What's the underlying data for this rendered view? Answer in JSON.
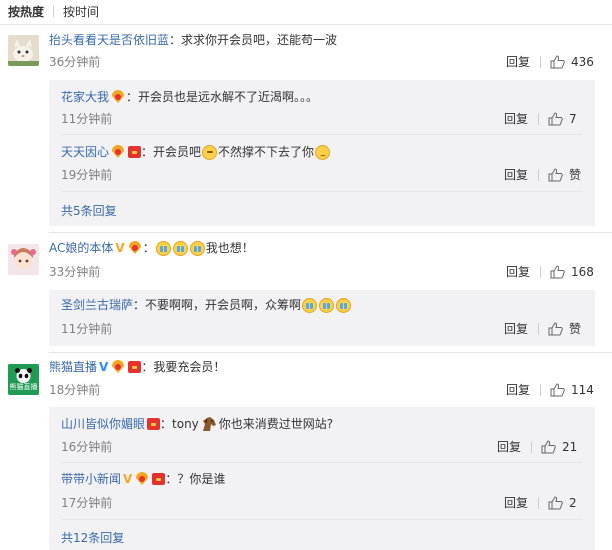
{
  "sort": {
    "hot": "按热度",
    "time": "按时间"
  },
  "comments": [
    {
      "user": "抬头看看天是否依旧蓝",
      "text": "求求你开会员吧，还能苟一波",
      "time": "36分钟前",
      "reply_label": "回复",
      "likes": "436",
      "replies": [
        {
          "user": "花家大我",
          "text": "开会员也是远水解不了近渴啊。。。",
          "time": "11分钟前",
          "reply_label": "回复",
          "likes": "7"
        },
        {
          "user": "天天因心",
          "text_a": "开会员吧",
          "text_b": "不然撑不下去了你",
          "time": "19分钟前",
          "reply_label": "回复",
          "likes": "赞"
        }
      ],
      "more": "共5条回复"
    },
    {
      "user": "AC娘的本体",
      "text": "我也想！",
      "time": "33分钟前",
      "reply_label": "回复",
      "likes": "168",
      "replies": [
        {
          "user": "圣剑兰古瑞萨",
          "text": "不要啊啊，开会员啊，众筹啊",
          "time": "11分钟前",
          "reply_label": "回复",
          "likes": "赞"
        }
      ]
    },
    {
      "user": "熊猫直播",
      "text": "我要充会员！",
      "time": "18分钟前",
      "reply_label": "回复",
      "likes": "114",
      "avatar_text": "熊猫直播",
      "replies": [
        {
          "user": "山川皆似你媚眼",
          "text_a": "tony",
          "text_b": "你也来消费过世网站?",
          "time": "16分钟前",
          "reply_label": "回复",
          "likes": "21"
        },
        {
          "user": "带带小新闻",
          "text": "？你是谁",
          "time": "17分钟前",
          "reply_label": "回复",
          "likes": "2"
        }
      ],
      "more": "共12条回复"
    }
  ],
  "colon": "：",
  "vmark": "V",
  "colors": {
    "link": "#3a6aa8",
    "reply_bg": "#f2f2f5",
    "time": "#808080",
    "vip_badge": "#f5a623",
    "red_packet": "#e5322d"
  }
}
